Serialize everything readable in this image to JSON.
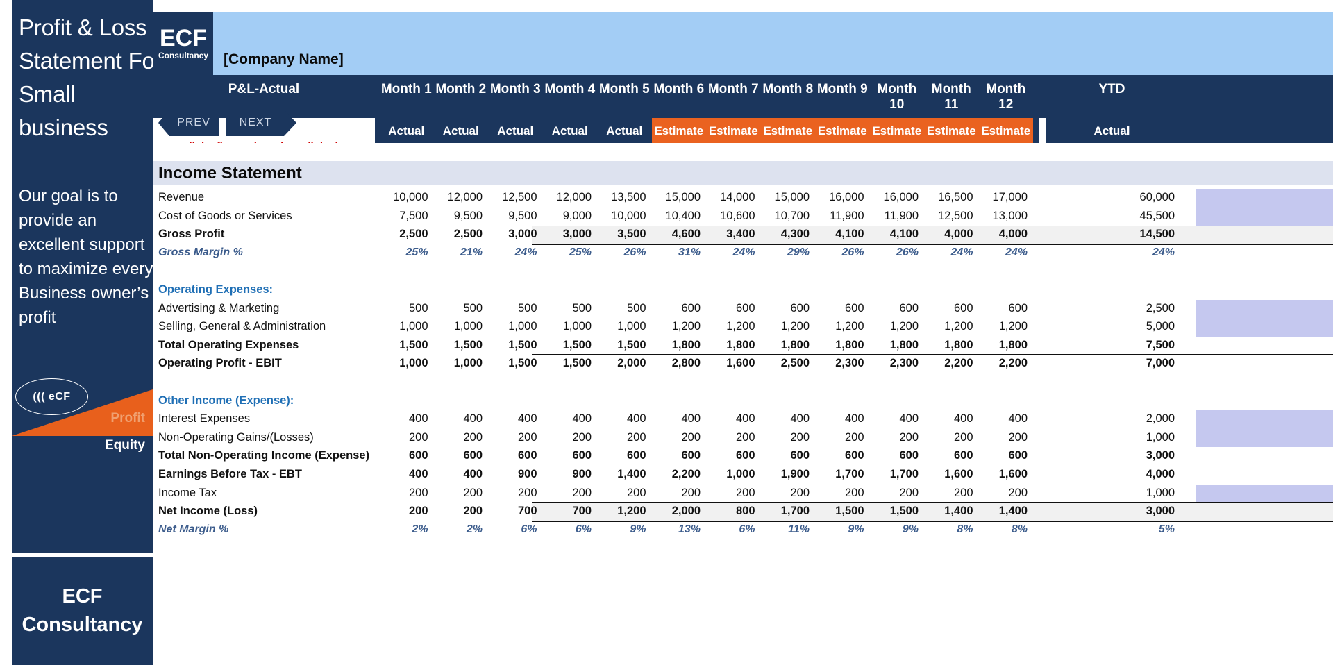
{
  "sidebar": {
    "title": "Profit & Loss Statement For Small business",
    "tagline": "Our goal is to provide an excellent support to maximize every Business owner’s profit",
    "badge_label": "((( eCF",
    "wedge_top_label": "Profit",
    "wedge_bottom_label": "Equity",
    "footer_line1": "ECF",
    "footer_line2": "Consultancy"
  },
  "brand": {
    "logo_line1": "ECF",
    "logo_line2": "Consultancy",
    "company_name": "[Company Name]",
    "accent_navy": "#1b365d",
    "accent_orange": "#ea6220",
    "header_blue": "#a3cdf5",
    "ytd_highlight": "#c5c8ef"
  },
  "toolbar": {
    "prev_label": "PREV",
    "next_label": "NEXT",
    "note": "N.B. All the figures have been linked"
  },
  "table": {
    "corner_label": "P&L-Actual",
    "columns": [
      "Month 1",
      "Month 2",
      "Month 3",
      "Month 4",
      "Month 5",
      "Month 6",
      "Month 7",
      "Month 8",
      "Month 9",
      "Month 10",
      "Month 11",
      "Month 12",
      "YTD"
    ],
    "subheaders": [
      "Actual",
      "Actual",
      "Actual",
      "Actual",
      "Actual",
      "Estimate",
      "Estimate",
      "Estimate",
      "Estimate",
      "Estimate",
      "Estimate",
      "Estimate",
      "Actual"
    ],
    "section_title": "Income Statement",
    "rows": [
      {
        "label": "Revenue",
        "style": "plain",
        "ytd_highlight": true,
        "values": [
          "10,000",
          "12,000",
          "12,500",
          "12,000",
          "13,500",
          "15,000",
          "14,000",
          "15,000",
          "16,000",
          "16,000",
          "16,500",
          "17,000",
          "60,000"
        ]
      },
      {
        "label": "Cost of Goods or Services",
        "style": "plain",
        "ytd_highlight": true,
        "values": [
          "7,500",
          "9,500",
          "9,500",
          "9,000",
          "10,000",
          "10,400",
          "10,600",
          "10,700",
          "11,900",
          "11,900",
          "12,500",
          "13,000",
          "45,500"
        ]
      },
      {
        "label": "Gross Profit",
        "style": "total",
        "band": true,
        "rule_bottom": true,
        "values": [
          "2,500",
          "2,500",
          "3,000",
          "3,000",
          "3,500",
          "4,600",
          "3,400",
          "4,300",
          "4,100",
          "4,100",
          "4,000",
          "4,000",
          "14,500"
        ]
      },
      {
        "label": "Gross Margin %",
        "style": "percent",
        "values": [
          "25%",
          "21%",
          "24%",
          "25%",
          "26%",
          "31%",
          "24%",
          "29%",
          "26%",
          "26%",
          "24%",
          "24%",
          "24%"
        ]
      },
      {
        "label": "",
        "style": "spacer",
        "values": [
          "",
          "",
          "",
          "",
          "",
          "",
          "",
          "",
          "",
          "",
          "",
          "",
          ""
        ]
      },
      {
        "label": "Operating Expenses:",
        "style": "subhead",
        "values": [
          "",
          "",
          "",
          "",
          "",
          "",
          "",
          "",
          "",
          "",
          "",
          "",
          ""
        ]
      },
      {
        "label": "Advertising & Marketing",
        "style": "plain",
        "ytd_highlight": true,
        "values": [
          "500",
          "500",
          "500",
          "500",
          "500",
          "600",
          "600",
          "600",
          "600",
          "600",
          "600",
          "600",
          "2,500"
        ]
      },
      {
        "label": "Selling, General & Administration",
        "style": "plain",
        "ytd_highlight": true,
        "values": [
          "1,000",
          "1,000",
          "1,000",
          "1,000",
          "1,000",
          "1,200",
          "1,200",
          "1,200",
          "1,200",
          "1,200",
          "1,200",
          "1,200",
          "5,000"
        ]
      },
      {
        "label": "Total Operating Expenses",
        "style": "total",
        "rule_bottom": true,
        "values": [
          "1,500",
          "1,500",
          "1,500",
          "1,500",
          "1,500",
          "1,800",
          "1,800",
          "1,800",
          "1,800",
          "1,800",
          "1,800",
          "1,800",
          "7,500"
        ]
      },
      {
        "label": "Operating Profit - EBIT",
        "style": "total",
        "values": [
          "1,000",
          "1,000",
          "1,500",
          "1,500",
          "2,000",
          "2,800",
          "1,600",
          "2,500",
          "2,300",
          "2,300",
          "2,200",
          "2,200",
          "7,000"
        ]
      },
      {
        "label": "",
        "style": "spacer",
        "values": [
          "",
          "",
          "",
          "",
          "",
          "",
          "",
          "",
          "",
          "",
          "",
          "",
          ""
        ]
      },
      {
        "label": "Other Income (Expense):",
        "style": "subhead",
        "values": [
          "",
          "",
          "",
          "",
          "",
          "",
          "",
          "",
          "",
          "",
          "",
          "",
          ""
        ]
      },
      {
        "label": "Interest Expenses",
        "style": "plain",
        "ytd_highlight": true,
        "values": [
          "400",
          "400",
          "400",
          "400",
          "400",
          "400",
          "400",
          "400",
          "400",
          "400",
          "400",
          "400",
          "2,000"
        ]
      },
      {
        "label": "Non-Operating Gains/(Losses)",
        "style": "plain",
        "ytd_highlight": true,
        "values": [
          "200",
          "200",
          "200",
          "200",
          "200",
          "200",
          "200",
          "200",
          "200",
          "200",
          "200",
          "200",
          "1,000"
        ]
      },
      {
        "label": "Total Non-Operating Income (Expense)",
        "style": "total",
        "values": [
          "600",
          "600",
          "600",
          "600",
          "600",
          "600",
          "600",
          "600",
          "600",
          "600",
          "600",
          "600",
          "3,000"
        ]
      },
      {
        "label": "Earnings Before Tax - EBT",
        "style": "total",
        "values": [
          "400",
          "400",
          "900",
          "900",
          "1,400",
          "2,200",
          "1,000",
          "1,900",
          "1,700",
          "1,700",
          "1,600",
          "1,600",
          "4,000"
        ]
      },
      {
        "label": "Income Tax",
        "style": "plain",
        "ytd_highlight": true,
        "rule_bottom": true,
        "values": [
          "200",
          "200",
          "200",
          "200",
          "200",
          "200",
          "200",
          "200",
          "200",
          "200",
          "200",
          "200",
          "1,000"
        ]
      },
      {
        "label": "Net Income (Loss)",
        "style": "total",
        "band": true,
        "rule_bottom": true,
        "values": [
          "200",
          "200",
          "700",
          "700",
          "1,200",
          "2,000",
          "800",
          "1,700",
          "1,500",
          "1,500",
          "1,400",
          "1,400",
          "3,000"
        ]
      },
      {
        "label": "Net Margin %",
        "style": "percent",
        "values": [
          "2%",
          "2%",
          "6%",
          "6%",
          "9%",
          "13%",
          "6%",
          "11%",
          "9%",
          "9%",
          "8%",
          "8%",
          "5%"
        ]
      }
    ]
  }
}
